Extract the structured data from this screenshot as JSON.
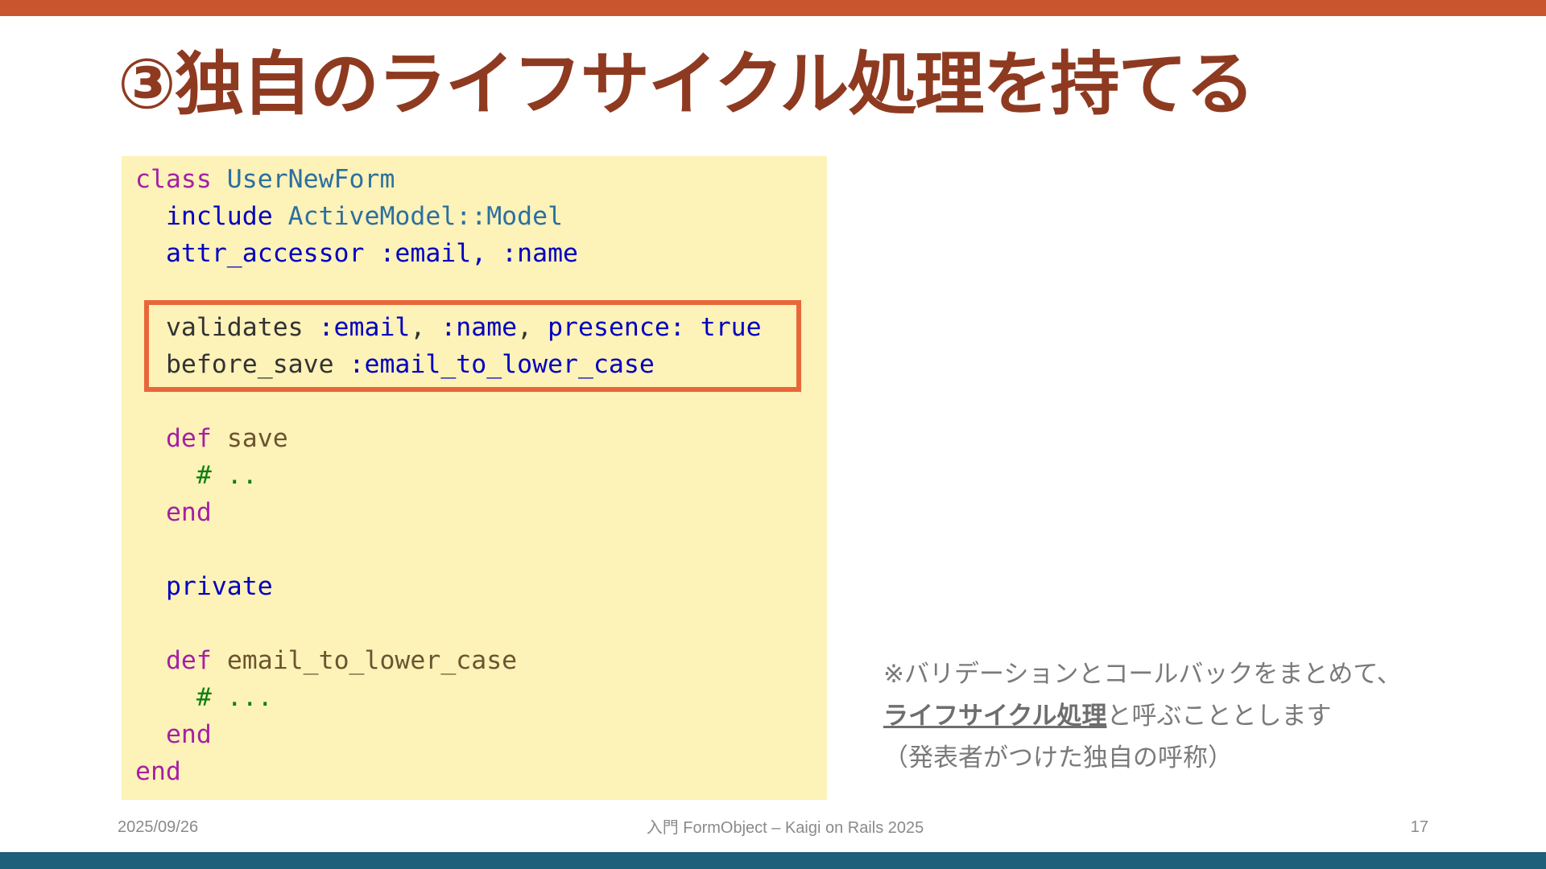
{
  "slide": {
    "title": "③独自のライフサイクル処理を持てる",
    "code": {
      "line1": {
        "kw": "class",
        "name": "UserNewForm"
      },
      "line2": {
        "kw": "include",
        "const": "ActiveModel::Model"
      },
      "line3": {
        "method": "attr_accessor",
        "args": ":email, :name"
      },
      "line4": {
        "method": "validates",
        "sym1": ":email",
        "sep1": ", ",
        "sym2": ":name",
        "sep2": ", ",
        "key": "presence:",
        "val": "true"
      },
      "line5": {
        "method": "before_save",
        "sym": ":email_to_lower_case"
      },
      "line6": {
        "kw": "def",
        "name": "save"
      },
      "line7": {
        "comment": "# .."
      },
      "line8": {
        "kw": "end"
      },
      "line9": {
        "kw": "private"
      },
      "line10": {
        "kw": "def",
        "name": "email_to_lower_case"
      },
      "line11": {
        "comment": "# ..."
      },
      "line12": {
        "kw": "end"
      },
      "line13": {
        "kw": "end"
      }
    },
    "note": {
      "line1": "※バリデーションとコールバックをまとめて、",
      "line2_emphasis": "ライフサイクル処理",
      "line2_rest": "と呼ぶこととします",
      "line3": "（発表者がつけた独自の呼称）"
    },
    "footer": {
      "date": "2025/09/26",
      "center": "入門 FormObject – Kaigi on Rails 2025",
      "page": "17"
    },
    "colors": {
      "top_bar": "#c8552e",
      "bottom_bar": "#1e5f7a",
      "title": "#8e3a21",
      "code_background": "#fdf2b8",
      "highlight_border": "#e8673a"
    }
  }
}
